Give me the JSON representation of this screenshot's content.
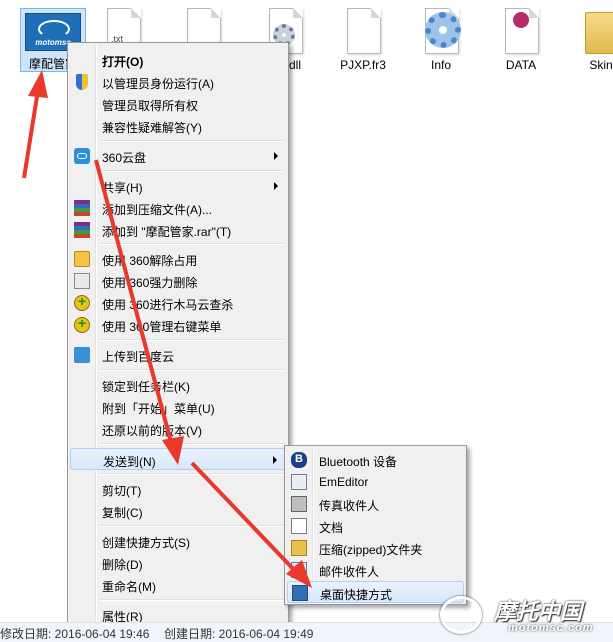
{
  "desktop": {
    "selected_file": {
      "label": "摩配管家",
      "logo_text": "motomsc"
    },
    "files": [
      {
        "label": "",
        "kind": "txt",
        "tag": ".txt"
      },
      {
        "label": "",
        "kind": "blank"
      },
      {
        "label": "dll",
        "kind": "dll"
      },
      {
        "label": "PJXP.fr3",
        "kind": "blank"
      },
      {
        "label": "Info",
        "kind": "gear"
      },
      {
        "label": "DATA",
        "kind": "access"
      },
      {
        "label": "Skin",
        "kind": "folder"
      }
    ]
  },
  "context_menu": {
    "items": [
      {
        "label": "打开(O)",
        "icon": "none",
        "bold": true
      },
      {
        "label": "以管理员身份运行(A)",
        "icon": "uac-shield-icon"
      },
      {
        "label": "管理员取得所有权",
        "icon": "none"
      },
      {
        "label": "兼容性疑难解答(Y)",
        "icon": "none"
      },
      {
        "label": "360云盘",
        "icon": "360-cloud-icon",
        "submenu": true
      },
      {
        "label": "共享(H)",
        "icon": "none",
        "submenu": true
      },
      {
        "label": "添加到压缩文件(A)...",
        "icon": "winrar-icon"
      },
      {
        "label": "添加到 \"摩配管家.rar\"(T)",
        "icon": "winrar-icon"
      },
      {
        "label": "使用 360解除占用",
        "icon": "unlock-icon"
      },
      {
        "label": "使用 360强力删除",
        "icon": "shredder-icon"
      },
      {
        "label": "使用 360进行木马云查杀",
        "icon": "360-scan-icon"
      },
      {
        "label": "使用 360管理右键菜单",
        "icon": "360-scan-icon"
      },
      {
        "label": "上传到百度云",
        "icon": "baidu-cloud-icon"
      },
      {
        "label": "锁定到任务栏(K)",
        "icon": "none"
      },
      {
        "label": "附到「开始」菜单(U)",
        "icon": "none"
      },
      {
        "label": "还原以前的版本(V)",
        "icon": "none"
      },
      {
        "label": "发送到(N)",
        "icon": "none",
        "submenu": true,
        "highlighted": true
      },
      {
        "label": "剪切(T)",
        "icon": "none"
      },
      {
        "label": "复制(C)",
        "icon": "none"
      },
      {
        "label": "创建快捷方式(S)",
        "icon": "none"
      },
      {
        "label": "删除(D)",
        "icon": "none"
      },
      {
        "label": "重命名(M)",
        "icon": "none"
      },
      {
        "label": "属性(R)",
        "icon": "none"
      }
    ]
  },
  "send_to_submenu": {
    "items": [
      {
        "label": "Bluetooth 设备",
        "icon": "bluetooth-icon"
      },
      {
        "label": "EmEditor",
        "icon": "emeditor-icon"
      },
      {
        "label": "传真收件人",
        "icon": "fax-icon"
      },
      {
        "label": "文档",
        "icon": "documents-icon"
      },
      {
        "label": "压缩(zipped)文件夹",
        "icon": "zip-folder-icon"
      },
      {
        "label": "邮件收件人",
        "icon": "mail-icon"
      },
      {
        "label": "桌面快捷方式",
        "icon": "desktop-icon",
        "highlighted": true
      }
    ]
  },
  "status_bar": {
    "modified": "修改日期: 2016-06-04 19:46",
    "created": "创建日期: 2016-06-04 19:49"
  },
  "watermark": {
    "title": "摩托中国",
    "url": "motomsc.com"
  },
  "colors": {
    "highlight": "#d9e8fb",
    "arrow": "#e8392c",
    "menu_bg": "#f0f0f0"
  }
}
